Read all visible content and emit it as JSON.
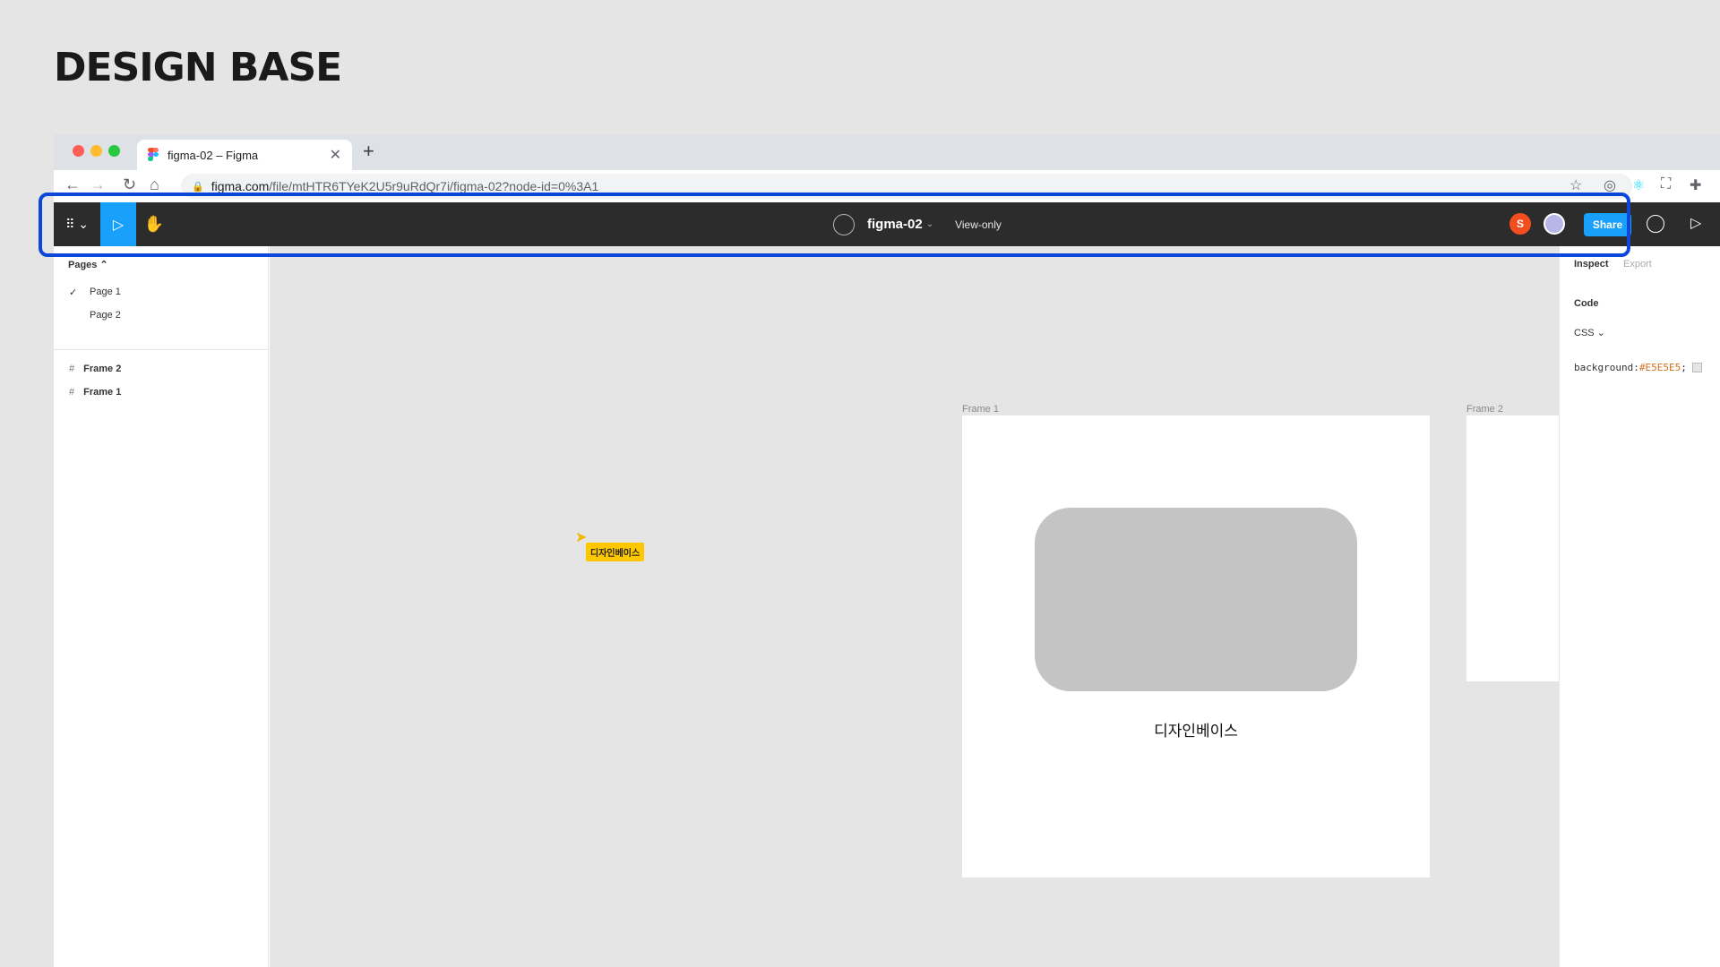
{
  "brand": {
    "title": "DESIGN BASE"
  },
  "browser": {
    "tab": {
      "title": "figma-02 – Figma",
      "close": "✕"
    },
    "new_tab": "+",
    "nav": {
      "back": "←",
      "forward": "→",
      "reload": "↻",
      "home": "⌂"
    },
    "url": {
      "host": "figma.com",
      "path": "/file/mtHTR6TYeK2U5r9uRdQr7i/figma-02?node-id=0%3A1",
      "lock": "🔒"
    },
    "bookmark": "☆",
    "extensions": [
      "◎",
      "⚛",
      "⛶",
      "✚"
    ]
  },
  "figma": {
    "menu_label": "⠿ ⌄",
    "move_tool": "▷",
    "hand_tool": "✋",
    "file_name": "figma-02",
    "file_chevron": "⌄",
    "mode": "View-only",
    "collaborator_initial": "S",
    "share_label": "Share",
    "play": "▷"
  },
  "left_panel": {
    "pages_title": "Pages ⌃",
    "pages": [
      "Page 1",
      "Page 2"
    ],
    "check": "✓",
    "layers": [
      "Frame 2",
      "Frame 1"
    ],
    "layer_icon": "#"
  },
  "canvas": {
    "frame1_label": "Frame 1",
    "frame2_label": "Frame 2",
    "frame1_text": "디자인베이스",
    "cursor_name": "디자인베이스"
  },
  "right_panel": {
    "tabs": [
      "Inspect",
      "Export"
    ],
    "code_title": "Code",
    "language": "CSS ⌄",
    "css_property": "background: ",
    "css_value": "#E5E5E5",
    "css_semicolon": ";"
  },
  "colors": {
    "figma_bar": "#2c2c2c",
    "accent_blue": "#18a0fb",
    "highlight": "#0d47d9",
    "collaborator": "#f24e1e",
    "cursor": "#ffc700"
  }
}
